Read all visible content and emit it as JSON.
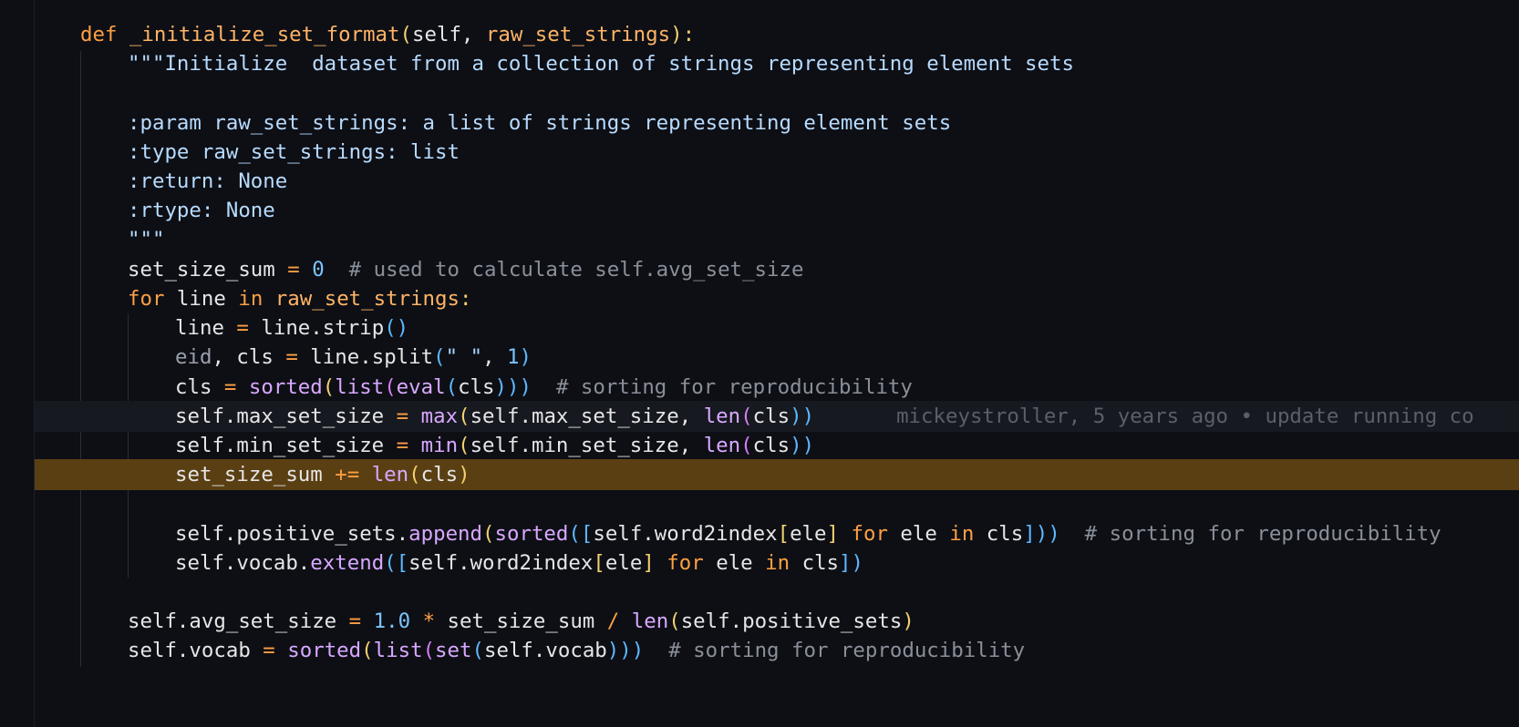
{
  "editor": {
    "language": "python",
    "lines": [
      {
        "parts": [
          "def",
          " ",
          "_initialize_set_format",
          "(",
          "self",
          ", ",
          "raw_set_strings",
          "):"
        ]
      },
      {
        "parts": [
          "\"\"\"Initialize  dataset from a collection of strings representing element sets"
        ]
      },
      {
        "parts": [
          ""
        ]
      },
      {
        "parts": [
          ":param raw_set_strings: a list of strings representing element sets"
        ]
      },
      {
        "parts": [
          ":type raw_set_strings: list"
        ]
      },
      {
        "parts": [
          ":return: None"
        ]
      },
      {
        "parts": [
          ":rtype: None"
        ]
      },
      {
        "parts": [
          "\"\"\""
        ]
      },
      {
        "parts": [
          "set_size_sum",
          " ",
          "=",
          " ",
          "0",
          "  ",
          "# used to calculate self.avg_set_size"
        ]
      },
      {
        "parts": [
          "for",
          " line ",
          "in",
          " ",
          "raw_set_strings",
          ":"
        ]
      },
      {
        "parts": [
          "line ",
          "=",
          " line.strip",
          "()"
        ]
      },
      {
        "parts": [
          "eid",
          ", cls ",
          "=",
          " line.split",
          "(",
          "\" \"",
          ", ",
          "1",
          ")"
        ]
      },
      {
        "parts": [
          "cls ",
          "=",
          " ",
          "sorted",
          "(",
          "list",
          "(",
          "eval",
          "(",
          "cls",
          ")))",
          "  ",
          "# sorting for reproducibility"
        ]
      },
      {
        "parts": [
          "self.max_set_size ",
          "=",
          " ",
          "max",
          "(",
          "self.max_set_size, ",
          "len",
          "(",
          "cls",
          "))"
        ]
      },
      {
        "parts": [
          "self.min_set_size ",
          "=",
          " ",
          "min",
          "(",
          "self.min_set_size, ",
          "len",
          "(",
          "cls",
          "))"
        ]
      },
      {
        "parts": [
          "set_size_sum ",
          "+=",
          " ",
          "len",
          "(",
          "cls",
          ")"
        ]
      },
      {
        "parts": [
          ""
        ]
      },
      {
        "parts": [
          "self.positive_sets.",
          "append",
          "(",
          "sorted",
          "([",
          "self.word2index",
          "[",
          "ele",
          "]",
          " ",
          "for",
          " ele ",
          "in",
          " cls",
          "]))",
          "  ",
          "# sorting for reproducibility"
        ]
      },
      {
        "parts": [
          "self.vocab.",
          "extend",
          "([",
          "self.word2index",
          "[",
          "ele",
          "]",
          " ",
          "for",
          " ele ",
          "in",
          " cls",
          "])"
        ]
      },
      {
        "parts": [
          ""
        ]
      },
      {
        "parts": [
          "self.avg_set_size ",
          "=",
          " ",
          "1.0",
          " ",
          "*",
          " set_size_sum ",
          "/",
          " ",
          "len",
          "(",
          "self.positive_sets",
          ")"
        ]
      },
      {
        "parts": [
          "self.vocab ",
          "=",
          " ",
          "sorted",
          "(",
          "list",
          "(",
          "set",
          "(",
          "self.vocab",
          ")))",
          "  ",
          "# sorting for reproducibility"
        ]
      }
    ],
    "blame": "mickeystroller, 5 years ago • update running co"
  },
  "colors": {
    "background": "#0d0f15",
    "highlight_line": "#5a3f13",
    "current_line": "#161920",
    "keyword": "#ff9f43",
    "comment": "#8a8f99"
  }
}
